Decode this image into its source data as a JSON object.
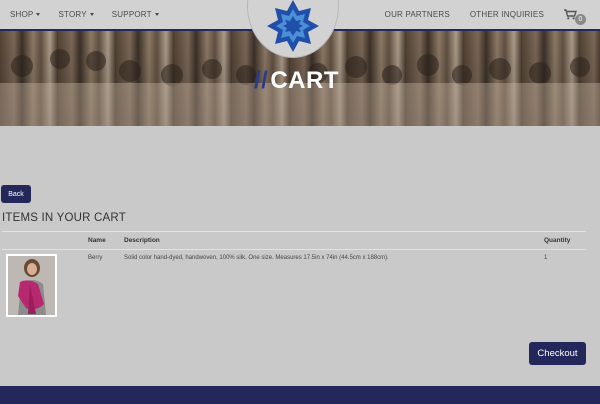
{
  "nav": {
    "left": [
      {
        "label": "SHOP"
      },
      {
        "label": "STORY"
      },
      {
        "label": "SUPPORT"
      }
    ],
    "right": [
      {
        "label": "OUR PARTNERS"
      },
      {
        "label": "OTHER INQUIRIES"
      }
    ],
    "cart_count": "0"
  },
  "hero": {
    "slashes": "//",
    "title": "CART"
  },
  "back_label": "Back",
  "section_title": "ITEMS IN YOUR CART",
  "table": {
    "headers": {
      "name": "Name",
      "description": "Description",
      "quantity": "Quantity"
    },
    "rows": [
      {
        "name": "Berry",
        "description": "Solid color hand-dyed, handwoven, 100% silk. One size. Measures 17.5in x 74in (44.5cm x 188cm).",
        "quantity": "1"
      }
    ]
  },
  "checkout_label": "Checkout",
  "colors": {
    "navy": "#23275a",
    "logo_blue": "#1f4fa8",
    "scarf": "#b8286e"
  },
  "icons": [
    "caret-down-icon",
    "cart-icon",
    "logo-star-icon"
  ]
}
